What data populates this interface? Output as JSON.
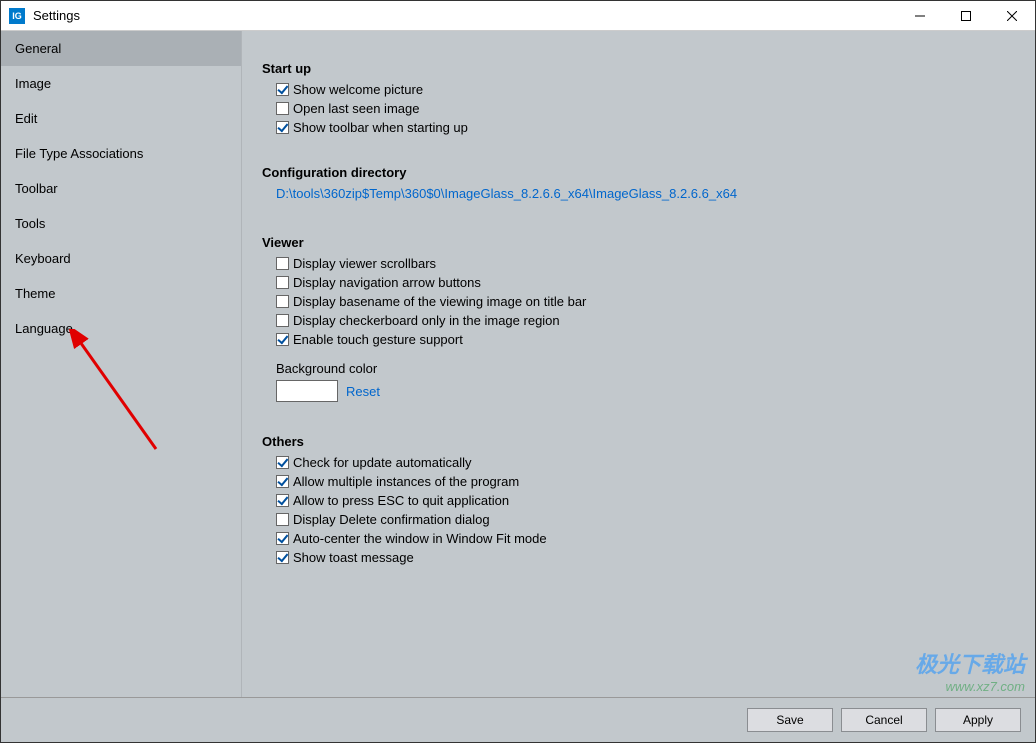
{
  "window": {
    "title": "Settings"
  },
  "sidebar": {
    "items": [
      {
        "label": "General",
        "selected": true
      },
      {
        "label": "Image"
      },
      {
        "label": "Edit"
      },
      {
        "label": "File Type Associations"
      },
      {
        "label": "Toolbar"
      },
      {
        "label": "Tools"
      },
      {
        "label": "Keyboard"
      },
      {
        "label": "Theme"
      },
      {
        "label": "Language"
      }
    ]
  },
  "main": {
    "startup": {
      "title": "Start up",
      "items": [
        {
          "label": "Show welcome picture",
          "checked": true
        },
        {
          "label": "Open last seen image",
          "checked": false
        },
        {
          "label": "Show toolbar when starting up",
          "checked": true
        }
      ]
    },
    "configdir": {
      "title": "Configuration directory",
      "path": "D:\\tools\\360zip$Temp\\360$0\\ImageGlass_8.2.6.6_x64\\ImageGlass_8.2.6.6_x64"
    },
    "viewer": {
      "title": "Viewer",
      "items": [
        {
          "label": "Display viewer scrollbars",
          "checked": false
        },
        {
          "label": "Display navigation arrow buttons",
          "checked": false
        },
        {
          "label": "Display basename of the viewing image on title bar",
          "checked": false
        },
        {
          "label": "Display checkerboard only in the image region",
          "checked": false
        },
        {
          "label": "Enable touch gesture support",
          "checked": true
        }
      ],
      "bgcolor_label": "Background color",
      "reset_label": "Reset"
    },
    "others": {
      "title": "Others",
      "items": [
        {
          "label": "Check for update automatically",
          "checked": true
        },
        {
          "label": "Allow multiple instances of the program",
          "checked": true
        },
        {
          "label": "Allow to press ESC to quit application",
          "checked": true
        },
        {
          "label": "Display Delete confirmation dialog",
          "checked": false
        },
        {
          "label": "Auto-center the window in Window Fit mode",
          "checked": true
        },
        {
          "label": "Show toast message",
          "checked": true
        }
      ]
    }
  },
  "footer": {
    "save": "Save",
    "cancel": "Cancel",
    "apply": "Apply"
  },
  "watermark": {
    "line1": "极光下载站",
    "line2": "www.xz7.com"
  }
}
